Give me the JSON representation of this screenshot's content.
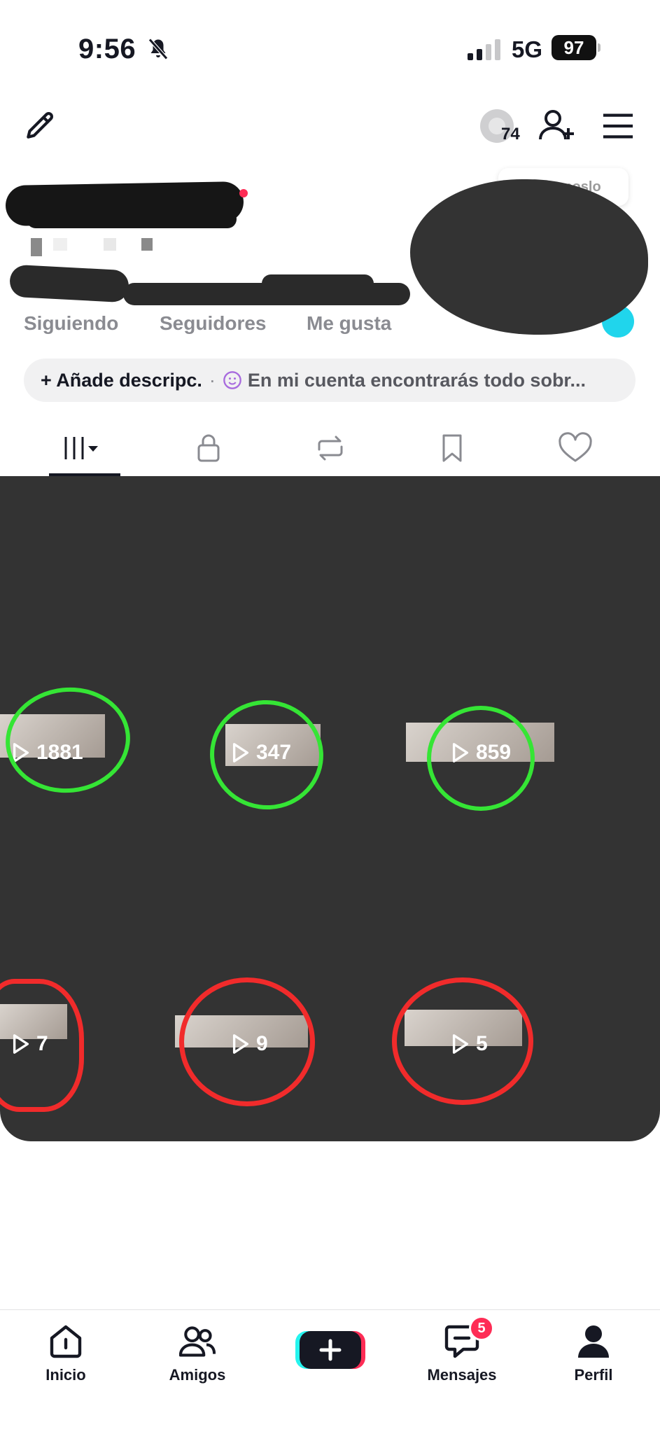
{
  "status_bar": {
    "time": "9:56",
    "network": "5G",
    "battery": "97"
  },
  "header": {
    "story_count": "74",
    "promo_pill": "Conócenoslo"
  },
  "profile": {
    "stats": [
      {
        "label": "Siguiendo"
      },
      {
        "label": "Seguidores"
      },
      {
        "label": "Me gusta"
      }
    ],
    "bio_add_label": "+ Añade descripc.",
    "bio_separator": "·",
    "bio_text": "En mi cuenta encontrarás todo sobr..."
  },
  "tabs": [
    {
      "icon": "grid-icon",
      "active": true
    },
    {
      "icon": "lock-icon"
    },
    {
      "icon": "repost-icon"
    },
    {
      "icon": "bookmark-icon"
    },
    {
      "icon": "heart-icon"
    }
  ],
  "videos": [
    {
      "views": "1881",
      "marker": "green"
    },
    {
      "views": "347",
      "marker": "green"
    },
    {
      "views": "859",
      "marker": "green"
    },
    {
      "views": "7",
      "marker": "red"
    },
    {
      "views": "9",
      "marker": "red"
    },
    {
      "views": "5",
      "marker": "red"
    }
  ],
  "bottom_nav": {
    "items": [
      {
        "label": "Inicio",
        "icon": "home-icon"
      },
      {
        "label": "Amigos",
        "icon": "friends-icon"
      },
      {
        "label": "",
        "icon": "create-icon"
      },
      {
        "label": "Mensajes",
        "icon": "inbox-icon"
      },
      {
        "label": "Perfil",
        "icon": "profile-icon"
      }
    ],
    "messages_badge": "5"
  },
  "colors": {
    "accent_pink": "#fe2c55",
    "accent_cyan": "#20d5ec",
    "redaction": "#333333",
    "green_marker": "#35e535",
    "red_marker": "#f12b2b"
  }
}
